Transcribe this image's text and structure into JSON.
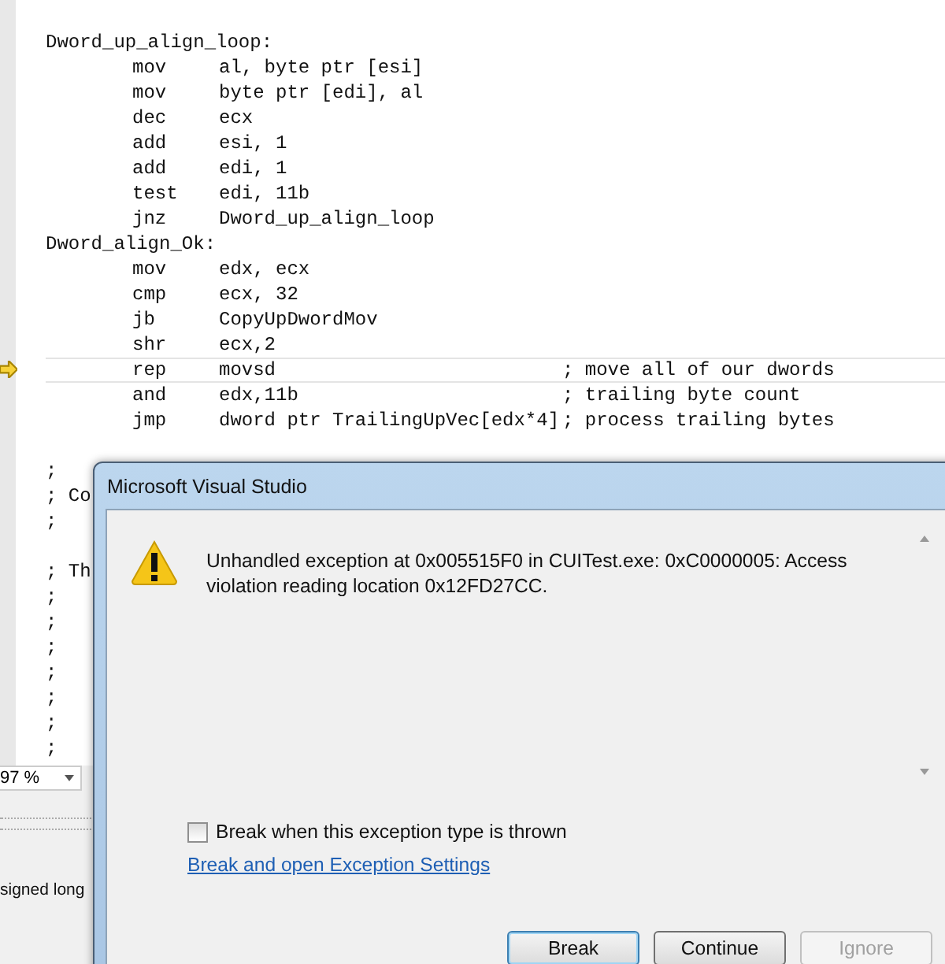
{
  "editor": {
    "lines": [
      {
        "kind": "label",
        "text": "Dword_up_align_loop:"
      },
      {
        "kind": "instr",
        "op": "mov",
        "args": "al, byte ptr [esi]"
      },
      {
        "kind": "instr",
        "op": "mov",
        "args": "byte ptr [edi], al"
      },
      {
        "kind": "instr",
        "op": "dec",
        "args": "ecx"
      },
      {
        "kind": "instr",
        "op": "add",
        "args": "esi, 1"
      },
      {
        "kind": "instr",
        "op": "add",
        "args": "edi, 1"
      },
      {
        "kind": "instr",
        "op": "test",
        "args": "edi, 11b"
      },
      {
        "kind": "instr",
        "op": "jnz",
        "args": "Dword_up_align_loop"
      },
      {
        "kind": "label",
        "text": "Dword_align_Ok:"
      },
      {
        "kind": "instr",
        "op": "mov",
        "args": "edx, ecx"
      },
      {
        "kind": "instr",
        "op": "cmp",
        "args": "ecx, 32"
      },
      {
        "kind": "instr",
        "op": "jb",
        "args": "CopyUpDwordMov"
      },
      {
        "kind": "instr",
        "op": "shr",
        "args": "ecx,2"
      },
      {
        "kind": "instr",
        "op": "rep",
        "args": "movsd",
        "comment": "; move all of our dwords",
        "current": true
      },
      {
        "kind": "instr",
        "op": "and",
        "args": "edx,11b",
        "comment": "; trailing byte count"
      },
      {
        "kind": "instr",
        "op": "jmp",
        "args": "dword ptr TrailingUpVec[edx*4]",
        "comment": "; process trailing bytes"
      },
      {
        "kind": "blank"
      },
      {
        "kind": "label",
        "text": ";"
      },
      {
        "kind": "label",
        "text": "; Co"
      },
      {
        "kind": "label",
        "text": ";"
      },
      {
        "kind": "blank"
      },
      {
        "kind": "label",
        "text": "; Th"
      },
      {
        "kind": "label",
        "text": ";"
      },
      {
        "kind": "label",
        "text": ";"
      },
      {
        "kind": "label",
        "text": ";"
      },
      {
        "kind": "label",
        "text": ";"
      },
      {
        "kind": "label",
        "text": ";"
      },
      {
        "kind": "label",
        "text": ";"
      },
      {
        "kind": "label",
        "text": ";"
      }
    ],
    "zoom": "97 %"
  },
  "side_panel": {
    "text": "signed long"
  },
  "dialog": {
    "title": "Microsoft Visual Studio",
    "message": "Unhandled exception at 0x005515F0 in CUITest.exe: 0xC0000005: Access violation reading location 0x12FD27CC.",
    "checkbox": {
      "label": "Break when this exception type is thrown",
      "checked": false
    },
    "link": "Break and open Exception Settings",
    "buttons": [
      {
        "label": "Break",
        "focused": true,
        "disabled": false
      },
      {
        "label": "Continue",
        "focused": false,
        "disabled": false
      },
      {
        "label": "Ignore",
        "focused": false,
        "disabled": true
      }
    ]
  }
}
